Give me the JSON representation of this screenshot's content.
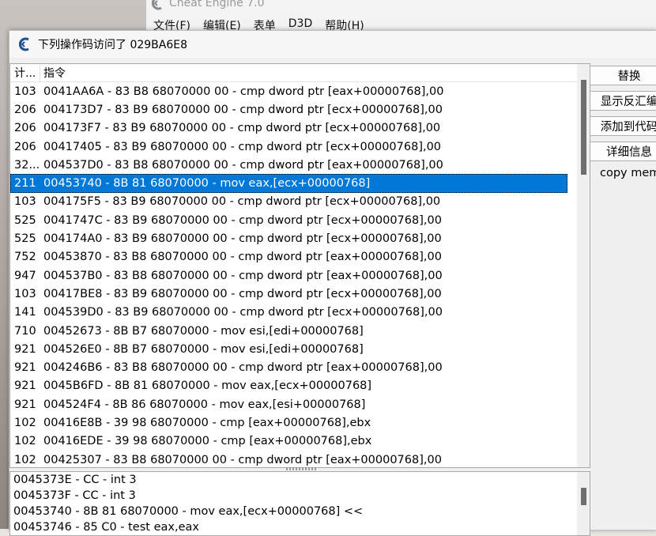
{
  "background_window": {
    "title": "Cheat Engine 7.0",
    "menu": [
      "文件(F)",
      "编辑(E)",
      "表单",
      "D3D",
      "帮助(H)"
    ]
  },
  "dialog": {
    "title": "下列操作码访问了 029BA6E8",
    "columns": {
      "count": "计...",
      "instruction": "指令"
    },
    "rows": [
      {
        "count": "103",
        "instr": "0041AA6A - 83 B8 68070000 00 - cmp dword ptr [eax+00000768],00"
      },
      {
        "count": "206",
        "instr": "004173D7 - 83 B9 68070000 00 - cmp dword ptr [ecx+00000768],00"
      },
      {
        "count": "206",
        "instr": "004173F7 - 83 B9 68070000 00 - cmp dword ptr [ecx+00000768],00"
      },
      {
        "count": "206",
        "instr": "00417405 - 83 B9 68070000 00 - cmp dword ptr [ecx+00000768],00"
      },
      {
        "count": "32...",
        "instr": "004537D0 - 83 B8 68070000 00 - cmp dword ptr [eax+00000768],00"
      },
      {
        "count": "211",
        "instr": "00453740 - 8B 81 68070000  - mov eax,[ecx+00000768]"
      },
      {
        "count": "103",
        "instr": "004175F5 - 83 B9 68070000 00 - cmp dword ptr [ecx+00000768],00"
      },
      {
        "count": "525",
        "instr": "0041747C - 83 B9 68070000 00 - cmp dword ptr [ecx+00000768],00"
      },
      {
        "count": "525",
        "instr": "004174A0 - 83 B9 68070000 00 - cmp dword ptr [ecx+00000768],00"
      },
      {
        "count": "752",
        "instr": "00453870 - 83 B8 68070000 00 - cmp dword ptr [eax+00000768],00"
      },
      {
        "count": "947",
        "instr": "004537B0 - 83 B8 68070000 00 - cmp dword ptr [eax+00000768],00"
      },
      {
        "count": "103",
        "instr": "00417BE8 - 83 B9 68070000 00 - cmp dword ptr [ecx+00000768],00"
      },
      {
        "count": "141",
        "instr": "004539D0 - 83 B9 68070000 00 - cmp dword ptr [ecx+00000768],00"
      },
      {
        "count": "710",
        "instr": "00452673 - 8B B7 68070000  - mov esi,[edi+00000768]"
      },
      {
        "count": "921",
        "instr": "004526E0 - 8B B7 68070000  - mov esi,[edi+00000768]"
      },
      {
        "count": "921",
        "instr": "004246B6 - 83 B8 68070000 00 - cmp dword ptr [eax+00000768],00"
      },
      {
        "count": "921",
        "instr": "0045B6FD - 8B 81 68070000  - mov eax,[ecx+00000768]"
      },
      {
        "count": "921",
        "instr": "004524F4 - 8B 86 68070000  - mov eax,[esi+00000768]"
      },
      {
        "count": "102",
        "instr": "00416E8B - 39 98 68070000  - cmp [eax+00000768],ebx"
      },
      {
        "count": "102",
        "instr": "00416EDE - 39 98 68070000  - cmp [eax+00000768],ebx"
      },
      {
        "count": "102",
        "instr": "00425307 - 83 B8 68070000 00 - cmp dword ptr [eax+00000768],00"
      }
    ],
    "selected_row_index": 5,
    "disassembly": [
      "0045373E - CC - int 3",
      "0045373F - CC - int 3",
      "00453740 - 8B 81 68070000  - mov eax,[ecx+00000768] <<",
      "00453746 - 85 C0 - test eax,eax"
    ],
    "buttons": {
      "replace": "替换",
      "show_disassembler": "显示反汇编",
      "add_to_codelist": "添加到代码",
      "more_info": "详细信息"
    },
    "copy_label": "copy mem"
  }
}
